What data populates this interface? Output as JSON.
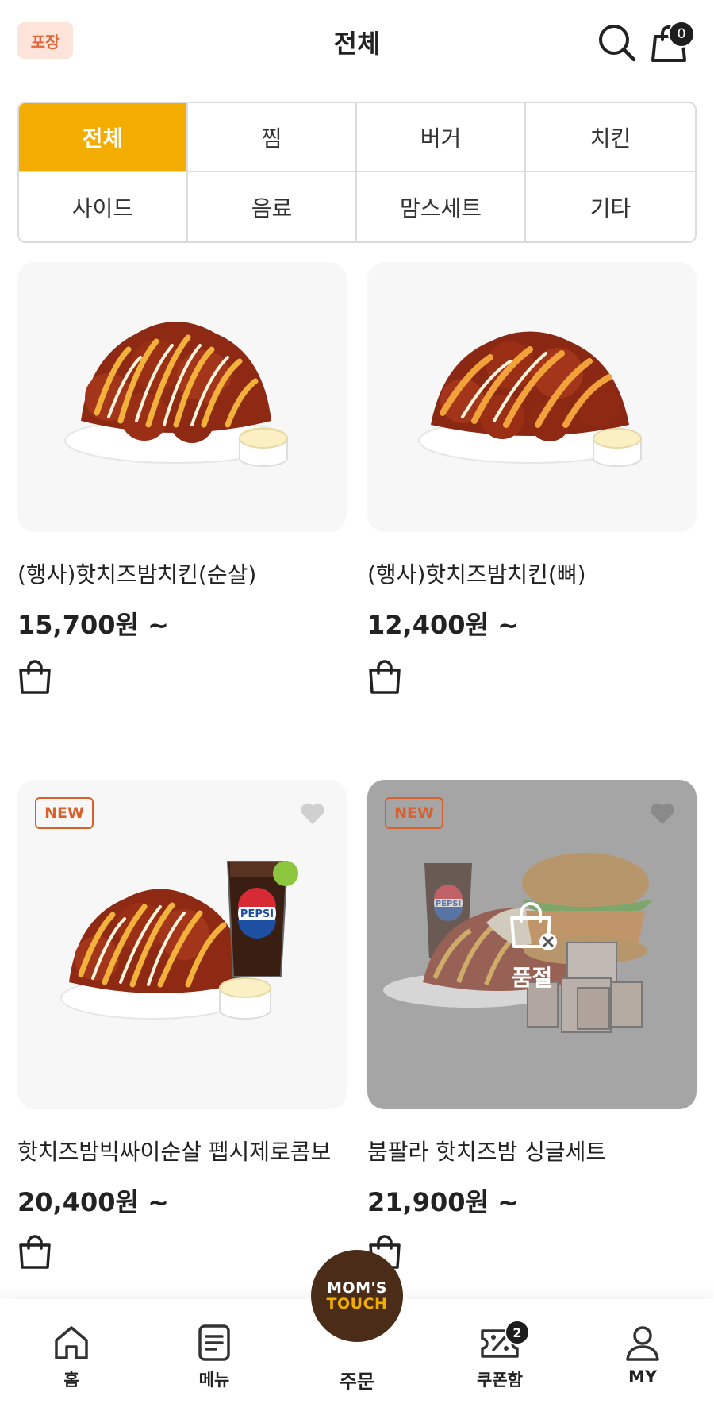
{
  "header": {
    "takeout_badge": "포장",
    "title": "전체",
    "cart_count": "0"
  },
  "categories": [
    {
      "label": "전체",
      "active": true
    },
    {
      "label": "찜",
      "active": false
    },
    {
      "label": "버거",
      "active": false
    },
    {
      "label": "치킨",
      "active": false
    },
    {
      "label": "사이드",
      "active": false
    },
    {
      "label": "음료",
      "active": false
    },
    {
      "label": "맘스세트",
      "active": false
    },
    {
      "label": "기타",
      "active": false
    }
  ],
  "products": [
    {
      "name": "(행사)핫치즈밤치킨(순살)",
      "price": "15,700원 ~",
      "new": false,
      "sold_out": false
    },
    {
      "name": "(행사)핫치즈밤치킨(뼈)",
      "price": "12,400원 ~",
      "new": false,
      "sold_out": false
    },
    {
      "name": "핫치즈밤빅싸이순살 펩시제로콤보",
      "price": "20,400원 ~",
      "new": true,
      "badge": "NEW",
      "sold_out": false
    },
    {
      "name": "붐팔라 핫치즈밤 싱글세트",
      "price": "21,900원 ~",
      "new": true,
      "badge": "NEW",
      "sold_out": true,
      "sold_out_label": "품절"
    }
  ],
  "product_image_labels": {
    "pepsi": "PEPSI"
  },
  "bottom_nav": {
    "home": "홈",
    "menu": "메뉴",
    "order": "주문",
    "order_logo_line1": "MOM'S",
    "order_logo_line2": "TOUCH",
    "coupon": "쿠폰함",
    "coupon_count": "2",
    "my": "MY"
  },
  "colors": {
    "accent": "#f2ad00",
    "brand_brown": "#4a2c18",
    "new_badge": "#d9602a",
    "takeout_bg": "#fde4db",
    "takeout_text": "#e0663a"
  }
}
